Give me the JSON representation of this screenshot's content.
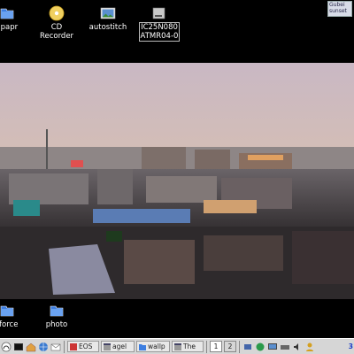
{
  "desktop": {
    "icons": [
      {
        "label": "llpapr",
        "icon": "folder-icon"
      },
      {
        "label": "CD\nRecorder",
        "icon": "cd-icon"
      },
      {
        "label": "autostitch",
        "icon": "image-icon"
      },
      {
        "label": "IC25N080\nATMR04-0",
        "icon": "hard-drive-icon"
      },
      {
        "label": "rforce",
        "icon": "folder-icon"
      },
      {
        "label": "photo",
        "icon": "folder-icon"
      }
    ]
  },
  "widget": {
    "line1": "Gubei",
    "line2": "sunset"
  },
  "taskbar": {
    "tasks": [
      {
        "label": "EOS",
        "icon": "pdf-icon"
      },
      {
        "label": "agel",
        "icon": "window-icon"
      },
      {
        "label": "wallp",
        "icon": "folder-icon"
      },
      {
        "label": "The",
        "icon": "window-icon"
      }
    ],
    "pager": [
      "1",
      "2"
    ],
    "clock": "3"
  },
  "colors": {
    "taskbar": "#d6d6d6",
    "clock": "#1a3cc8",
    "folder": "#3d7ee0"
  }
}
